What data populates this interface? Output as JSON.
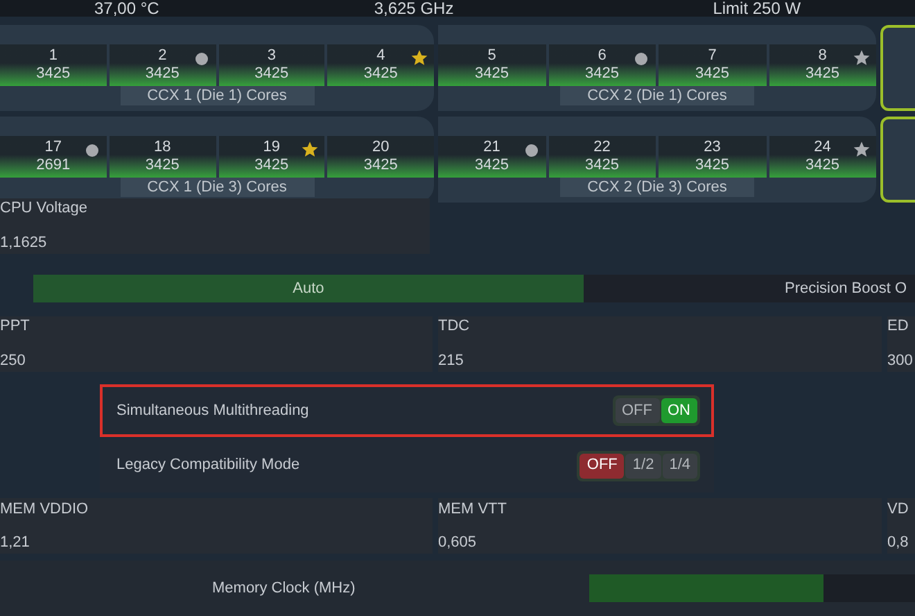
{
  "top_bar": [
    "37,00 °C",
    "3,625 GHz",
    "Limit 250 W"
  ],
  "core_rows": [
    {
      "groups": [
        {
          "label": "CCX 1 (Die 1) Cores",
          "cores": [
            {
              "number": "1",
              "clock": "3425",
              "kind": "plain"
            },
            {
              "number": "2",
              "clock": "3425",
              "kind": "dot"
            },
            {
              "number": "3",
              "clock": "3425",
              "kind": "plain"
            },
            {
              "number": "4",
              "clock": "3425",
              "kind": "star",
              "color": "#d9b21e"
            }
          ]
        },
        {
          "label": "CCX 2 (Die 1) Cores",
          "cores": [
            {
              "number": "5",
              "clock": "3425",
              "kind": "plain"
            },
            {
              "number": "6",
              "clock": "3425",
              "kind": "dot"
            },
            {
              "number": "7",
              "clock": "3425",
              "kind": "plain"
            },
            {
              "number": "8",
              "clock": "3425",
              "kind": "star",
              "color": "#a9acb0"
            }
          ]
        }
      ]
    },
    {
      "groups": [
        {
          "label": "CCX 1 (Die 3) Cores",
          "cores": [
            {
              "number": "17",
              "clock": "2691",
              "kind": "dot"
            },
            {
              "number": "18",
              "clock": "3425",
              "kind": "plain"
            },
            {
              "number": "19",
              "clock": "3425",
              "kind": "star",
              "color": "#d9b21e"
            },
            {
              "number": "20",
              "clock": "3425",
              "kind": "plain"
            }
          ]
        },
        {
          "label": "CCX 2 (Die 3) Cores",
          "cores": [
            {
              "number": "21",
              "clock": "3425",
              "kind": "dot"
            },
            {
              "number": "22",
              "clock": "3425",
              "kind": "plain"
            },
            {
              "number": "23",
              "clock": "3425",
              "kind": "plain"
            },
            {
              "number": "24",
              "clock": "3425",
              "kind": "star",
              "color": "#a9acb0"
            }
          ]
        }
      ]
    }
  ],
  "cpu_voltage": {
    "label": "CPU Voltage",
    "value": "1,1625"
  },
  "boost_mode": [
    {
      "label": "Auto",
      "selected": true
    },
    {
      "label": "Precision Boost O",
      "selected": false
    }
  ],
  "limits": [
    {
      "label": "PPT",
      "value": "250"
    },
    {
      "label": "TDC",
      "value": "215"
    },
    {
      "label": "ED",
      "value": "300"
    }
  ],
  "smt": {
    "label": "Simultaneous Multithreading",
    "highlighted": true,
    "options": [
      {
        "label": "OFF",
        "selected": false
      },
      {
        "label": "ON",
        "selected": true,
        "color": "#1f9a2e"
      }
    ]
  },
  "legacy": {
    "label": "Legacy Compatibility Mode",
    "highlighted": false,
    "options": [
      {
        "label": "OFF",
        "selected": true,
        "color": "#8e2b30"
      },
      {
        "label": "1/2",
        "selected": false
      },
      {
        "label": "1/4",
        "selected": false
      }
    ]
  },
  "memory_voltages": [
    {
      "label": "MEM VDDIO",
      "value": "1,21"
    },
    {
      "label": "MEM VTT",
      "value": "0,605"
    },
    {
      "label": "VD",
      "value": "0,8"
    }
  ],
  "memory_clock": {
    "label": "Memory Clock (MHz)",
    "level": 0.72
  }
}
